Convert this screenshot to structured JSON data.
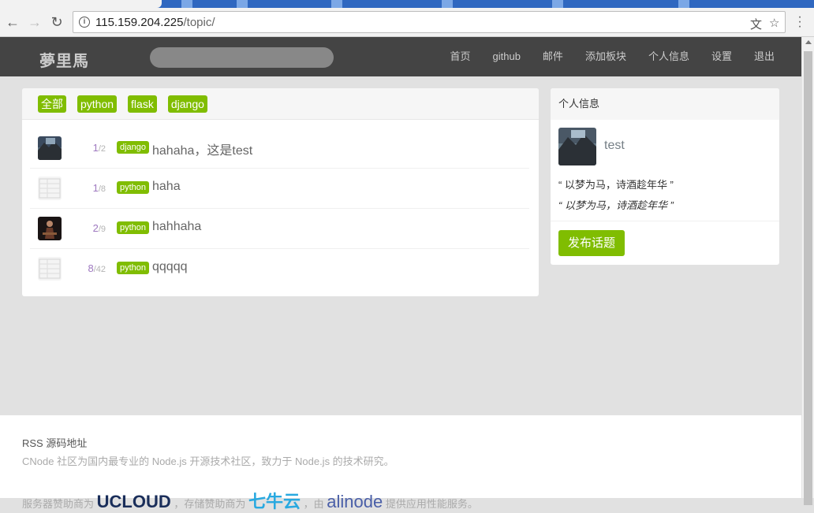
{
  "browser": {
    "url_host": "115.159.204.225",
    "url_path": "/topic/"
  },
  "header": {
    "brand": "夢里馬",
    "search_placeholder": "",
    "nav": [
      "首页",
      "github",
      "邮件",
      "添加板块",
      "个人信息",
      "设置",
      "退出"
    ]
  },
  "tabs": [
    "全部",
    "python",
    "flask",
    "django"
  ],
  "topics": [
    {
      "replies": "1",
      "views": "2",
      "tag": "django",
      "title": "hahaha，这是test",
      "avatar": "landscape"
    },
    {
      "replies": "1",
      "views": "8",
      "tag": "python",
      "title": "haha",
      "avatar": "blank"
    },
    {
      "replies": "2",
      "views": "9",
      "tag": "python",
      "title": "hahhaha",
      "avatar": "figure"
    },
    {
      "replies": "8",
      "views": "42",
      "tag": "python",
      "title": "qqqqq",
      "avatar": "blank"
    }
  ],
  "sidebar": {
    "title": "个人信息",
    "username": "test",
    "signature": "“ 以梦为马，诗酒趁年华 ”",
    "signature_italic": "“ 以梦为马，诗酒趁年华 ”",
    "post_button": "发布话题"
  },
  "footer": {
    "links": "RSS 源码地址",
    "desc": "CNode 社区为国内最专业的 Node.js 开源技术社区，致力于 Node.js 的技术研究。",
    "sponsor1": "服务器赞助商为",
    "sponsor1_logo": "UCLOUD",
    "sponsor2": "，存储赞助商为",
    "sponsor2_logo": "七牛云",
    "sponsor3": "，由",
    "sponsor3_logo": "alinode",
    "sponsor4": "提供应用性能服务。"
  },
  "colors": {
    "accent": "#80bd01",
    "header_bg": "#444444",
    "page_bg": "#e1e1e1"
  }
}
